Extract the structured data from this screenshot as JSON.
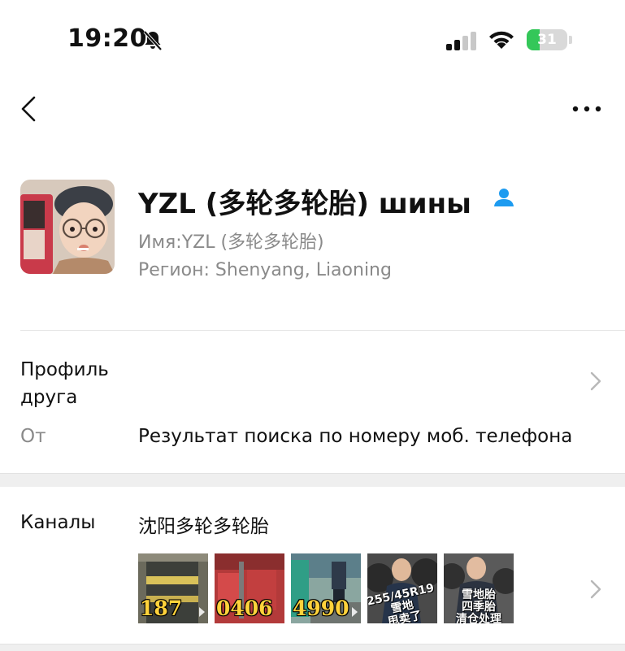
{
  "status_bar": {
    "time": "19:20",
    "battery": "31",
    "battery_level": 0.31,
    "icons": [
      "bell-slash-icon",
      "cellular-signal-icon",
      "wifi-icon",
      "battery-charging-icon"
    ]
  },
  "nav": {
    "back_icon": "chevron-left-icon",
    "more_icon": "ellipsis-icon"
  },
  "profile": {
    "display_name": "YZL (多轮多轮胎) шины",
    "nickname": "Имя:YZL (多轮多轮胎)",
    "region": "Регион: Shenyang, Liaoning",
    "contact_icon": "person-icon"
  },
  "friend_profile": {
    "label": "Профиль друга",
    "source_label": "От",
    "source_value": "Результат поиска по номеру моб. телефона"
  },
  "channels": {
    "label": "Каналы",
    "name": "沈阳多轮多轮胎",
    "thumbnails": [
      {
        "caption": "187"
      },
      {
        "caption": "0406"
      },
      {
        "caption": "4990"
      },
      {
        "caption": "255/45R19\n雪地\n甩卖了"
      },
      {
        "caption": "雪地胎\n四季胎\n清仓处理"
      }
    ]
  },
  "colors": {
    "accent_blue": "#1d9bf0",
    "battery_green": "#34c759",
    "secondary_text": "#8a8a8a",
    "caption_yellow": "#ffd23b"
  }
}
